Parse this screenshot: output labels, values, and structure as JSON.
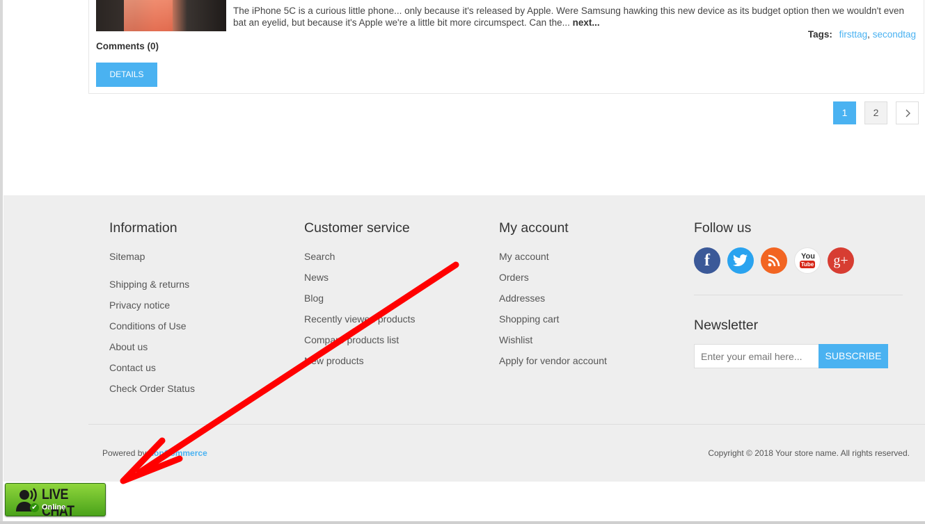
{
  "post": {
    "excerpt": "The iPhone 5C is a curious little phone... only because it's released by Apple. Were Samsung hawking this new device as its budget option then we wouldn't even bat an eyelid, but because it's Apple we're a little bit more circumspect. Can the...",
    "next_label": "next...",
    "tags_label": "Tags:",
    "tags": [
      "firsttag",
      "secondtag"
    ],
    "comments": "Comments (0)",
    "details_button": "DETAILS"
  },
  "pagination": {
    "pages": [
      "1",
      "2"
    ],
    "next_icon": "chevron-right-icon"
  },
  "footer": {
    "information": {
      "title": "Information",
      "links": [
        "Sitemap",
        "Shipping & returns",
        "Privacy notice",
        "Conditions of Use",
        "About us",
        "Contact us",
        "Check Order Status"
      ]
    },
    "customer_service": {
      "title": "Customer service",
      "links": [
        "Search",
        "News",
        "Blog",
        "Recently viewed products",
        "Compare products list",
        "New products"
      ]
    },
    "my_account": {
      "title": "My account",
      "links": [
        "My account",
        "Orders",
        "Addresses",
        "Shopping cart",
        "Wishlist",
        "Apply for vendor account"
      ]
    },
    "follow": {
      "title": "Follow us",
      "networks": [
        {
          "name": "facebook-icon",
          "glyph": "f",
          "color": "#3b5998"
        },
        {
          "name": "twitter-icon",
          "glyph": "t",
          "color": "#2aa3ef"
        },
        {
          "name": "rss-icon",
          "glyph": "rss",
          "color": "#f26522"
        },
        {
          "name": "youtube-icon",
          "glyph": "You Tube",
          "color": "#ffffff"
        },
        {
          "name": "google-plus-icon",
          "glyph": "g+",
          "color": "#d73d32"
        }
      ]
    },
    "newsletter": {
      "title": "Newsletter",
      "placeholder": "Enter your email here...",
      "button": "SUBSCRIBE"
    },
    "powered_prefix": "Powered by",
    "powered_link": "nopCommerce",
    "copyright": "Copyright © 2018 Your store name. All rights reserved."
  },
  "livechat": {
    "title": "LIVE CHAT",
    "status": "Online"
  },
  "colors": {
    "accent": "#4ab2f1",
    "annotation_arrow": "#ff0000",
    "footer_bg": "#eeeeee"
  }
}
